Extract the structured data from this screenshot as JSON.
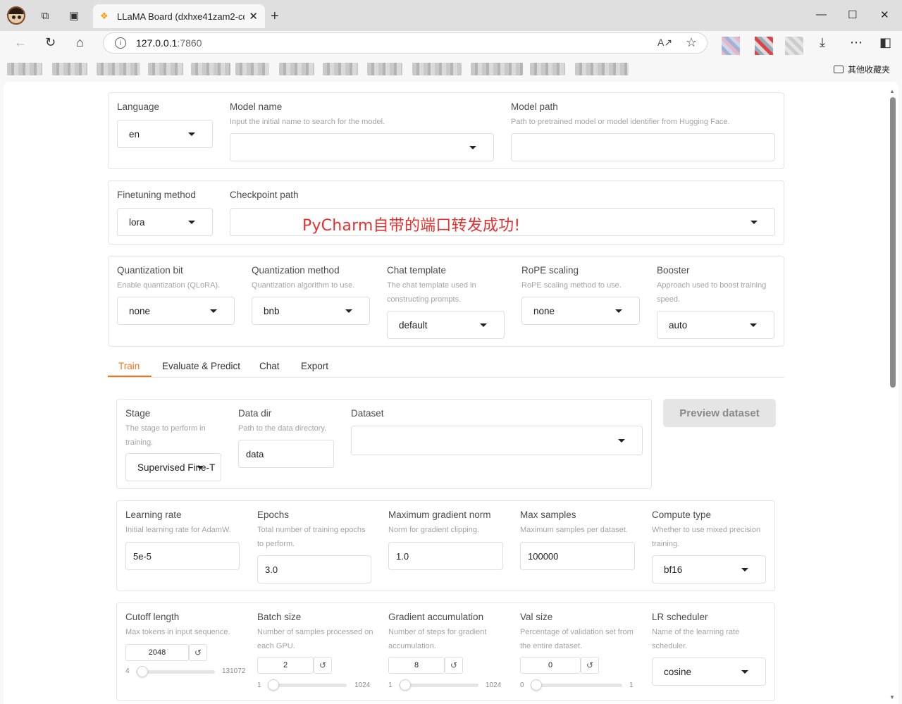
{
  "browser": {
    "tab_title": "LLaMA Board (dxhxe41zam2-cqw...",
    "new_tab": "+",
    "url_host": "127.0.0.1",
    "url_port": ":7860",
    "bookmark_folder": "其他收藏夹",
    "icons": [
      "back-icon",
      "refresh-icon",
      "home-icon",
      "read-aloud-icon",
      "favorite-icon",
      "download-icon",
      "more-icon",
      "sidebar-icon"
    ]
  },
  "top": {
    "language": {
      "label": "Language",
      "value": "en"
    },
    "model_name": {
      "label": "Model name",
      "info": "Input the initial name to search for the model.",
      "value": ""
    },
    "model_path": {
      "label": "Model path",
      "info": "Path to pretrained model or model identifier from Hugging Face.",
      "value": ""
    }
  },
  "ft": {
    "method": {
      "label": "Finetuning method",
      "value": "lora"
    },
    "checkpoint": {
      "label": "Checkpoint path",
      "value": ""
    }
  },
  "annotation": "PyCharm自带的端口转发成功!",
  "adv": {
    "quant_bit": {
      "label": "Quantization bit",
      "info": "Enable quantization (QLoRA).",
      "value": "none"
    },
    "quant_method": {
      "label": "Quantization method",
      "info": "Quantization algorithm to use.",
      "value": "bnb"
    },
    "template": {
      "label": "Chat template",
      "info": "The chat template used in constructing prompts.",
      "value": "default"
    },
    "rope": {
      "label": "RoPE scaling",
      "info": "RoPE scaling method to use.",
      "value": "none"
    },
    "booster": {
      "label": "Booster",
      "info": "Approach used to boost training speed.",
      "value": "auto"
    }
  },
  "tabs": [
    "Train",
    "Evaluate & Predict",
    "Chat",
    "Export"
  ],
  "train": {
    "stage": {
      "label": "Stage",
      "info": "The stage to perform in training.",
      "value": "Supervised Fine-T"
    },
    "data_dir": {
      "label": "Data dir",
      "info": "Path to the data directory.",
      "value": "data"
    },
    "dataset": {
      "label": "Dataset",
      "value": ""
    },
    "preview_button": "Preview dataset",
    "lr": {
      "label": "Learning rate",
      "info": "Initial learning rate for AdamW.",
      "value": "5e-5"
    },
    "epochs": {
      "label": "Epochs",
      "info": "Total number of training epochs to perform.",
      "value": "3.0"
    },
    "grad_norm": {
      "label": "Maximum gradient norm",
      "info": "Norm for gradient clipping.",
      "value": "1.0"
    },
    "max_samples": {
      "label": "Max samples",
      "info": "Maximum samples per dataset.",
      "value": "100000"
    },
    "compute": {
      "label": "Compute type",
      "info": "Whether to use mixed precision training.",
      "value": "bf16"
    },
    "cutoff": {
      "label": "Cutoff length",
      "info": "Max tokens in input sequence.",
      "value": "2048",
      "min": "4",
      "max": "131072",
      "level": 0.015
    },
    "batch": {
      "label": "Batch size",
      "info": "Number of samples processed on each GPU.",
      "value": "2",
      "min": "1",
      "max": "1024",
      "level": 0.001
    },
    "grad_acc": {
      "label": "Gradient accumulation",
      "info": "Number of steps for gradient accumulation.",
      "value": "8",
      "min": "1",
      "max": "1024",
      "level": 0.007
    },
    "val": {
      "label": "Val size",
      "info": "Percentage of validation set from the entire dataset.",
      "value": "0",
      "min": "0",
      "max": "1",
      "level": 0
    },
    "lr_sched": {
      "label": "LR scheduler",
      "info": "Name of the learning rate scheduler.",
      "value": "cosine"
    },
    "reset_glyph": "↺"
  }
}
